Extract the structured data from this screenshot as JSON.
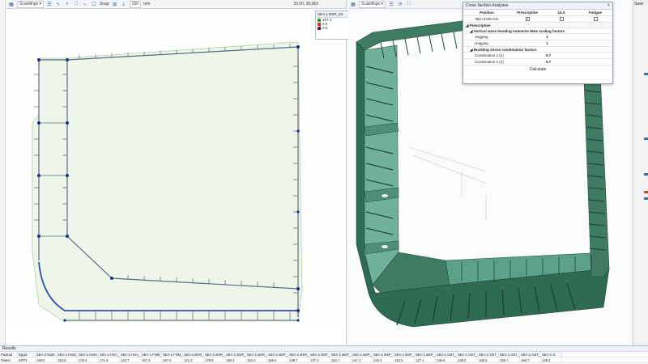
{
  "toolbar2d": {
    "view_select": "Scantlings",
    "snap_label": "Snap",
    "grid_value": "150",
    "grid_unit": "mm",
    "coords": "23,00; 20,063"
  },
  "legend2d": {
    "title": "SEA-1 BSR_2S",
    "entries": [
      {
        "label": "167.4",
        "color": "#2e9a3a"
      },
      {
        "label": "0.0",
        "color": "#d0302a"
      },
      {
        "label": "0.0",
        "color": "#7a1418"
      }
    ]
  },
  "toolbar3d": {
    "view_select": "Scantlings"
  },
  "cross_section_panel": {
    "title": "Cross Section Analyses",
    "columns": [
      "Position",
      "Prescriptive",
      "ULS",
      "Fatigue"
    ],
    "position_row": {
      "position": "#82+2125 mm",
      "prescriptive": "✓",
      "uls": "",
      "fatigue": ""
    },
    "section_label": "Prescriptive",
    "subsection1": "Vertical wave bending moments Mwv scaling factors",
    "sagging_label": "Sagging",
    "sagging_value": "1",
    "hogging_label": "Hogging",
    "hogging_value": "1",
    "subsection2": "Buckling stress combination factors",
    "comb1_label": "Combination 1 (1)",
    "comb1_value": "0.7",
    "comb2_label": "Combination 2 (2)",
    "comb2_value": "0.7",
    "calculate_label": "Calculate"
  },
  "right_sidebar": {
    "title": "Save"
  },
  "results": {
    "title": "Results",
    "headers": [
      "Pastoid",
      "Epyid",
      "SEA-2 Nwfe",
      "SEA-1 HSM_1",
      "SEA-1 HSM_2",
      "SEA-1 HSA_1",
      "SEA-1 HSA_2",
      "SEA-1 FSM_1",
      "SEA-1 FSM_2",
      "SEA-1 BSR_1P",
      "SEA-1 BSR_1S",
      "SEA-1 BSR_2P",
      "SEA-1 BSR_2S",
      "SEA-1 BSP_1S",
      "SEA-1 BSR_2S",
      "SEA-1 BSP_1P",
      "SEA-1 BSP_1S",
      "SEA-1 BSP_2P",
      "SEA-1 BSP_2S",
      "SEA-1 BSP_1S",
      "SEA-1 BSP_2S",
      "SEA-1 OST_1P",
      "SEA-1 OST_1S",
      "SEA-1 OST_2P",
      "SEA-1 OST_2S",
      "SEA-1 OST_1S",
      "SEA-1 O"
    ],
    "row": [
      "Plate0",
      "EPP1",
      "159.0",
      "150.8",
      "129.4",
      "171.6",
      "133.7",
      "167.4",
      "167.0",
      "121.0",
      "179.9",
      "186.4",
      "162.0",
      "155.0",
      "139.7",
      "137.3",
      "162.7",
      "147.1",
      "134.4",
      "154.5",
      "137.1",
      "136.6",
      "139.2",
      "165.5",
      "158.7",
      "156.7",
      "139.2"
    ]
  }
}
